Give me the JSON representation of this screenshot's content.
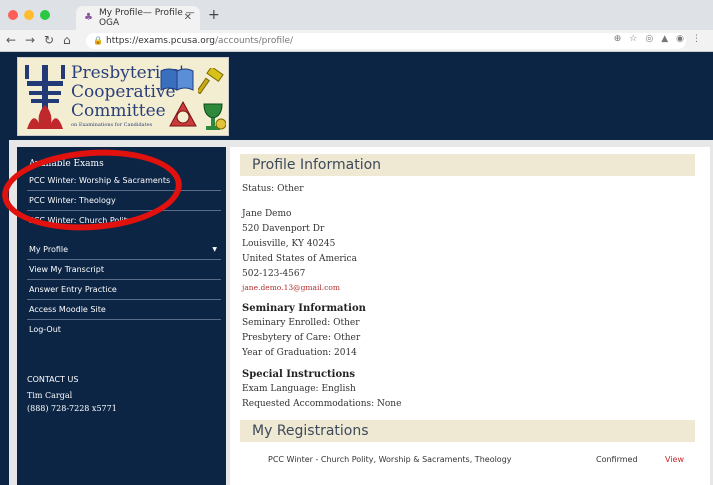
{
  "browser": {
    "tab_title": "My Profile— Profile — OGA",
    "url_host": "https://exams.pcusa.org",
    "url_path": "/accounts/profile/"
  },
  "logo": {
    "line1": "Presbyteries'",
    "line2": "Cooperative",
    "line3": "Committee",
    "line4": "on Examinations for Candidates"
  },
  "sidebar": {
    "exams_heading": "Available Exams",
    "exams": [
      {
        "label": "PCC Winter: Worship & Sacraments"
      },
      {
        "label": "PCC Winter: Theology"
      },
      {
        "label": "PCC Winter: Church Polity"
      }
    ],
    "menu": [
      {
        "label": "My Profile"
      },
      {
        "label": "View My Transcript"
      },
      {
        "label": "Answer Entry Practice"
      },
      {
        "label": "Access Moodle Site"
      },
      {
        "label": "Log-Out"
      }
    ],
    "contact_heading": "CONTACT US",
    "contact_name": "Tim Cargal",
    "contact_phone": "(888) 728-7228 x5771"
  },
  "profile": {
    "heading": "Profile Information",
    "status": "Status: Other",
    "name": "Jane Demo",
    "address1": "520 Davenport Dr",
    "address2": "Louisville, KY 40245",
    "country": "United States of America",
    "phone": "502-123-4567",
    "email": "jane.demo.13@gmail.com",
    "seminary_heading": "Seminary Information",
    "seminary_enrolled": "Seminary Enrolled: Other",
    "presbytery": "Presbytery of Care: Other",
    "graduation": "Year of Graduation: 2014",
    "special_heading": "Special Instructions",
    "language": "Exam Language: English",
    "accommodations": "Requested Accommodations: None"
  },
  "registrations": {
    "heading": "My Registrations",
    "items": [
      {
        "name": "PCC Winter - Church Polity, Worship & Sacraments, Theology",
        "status": "Confirmed",
        "action": "View"
      }
    ]
  },
  "colors": {
    "navy": "#0c2545",
    "highlight_circle": "#e1110e",
    "section_bar": "#efe8d3",
    "link_red": "#c62828"
  }
}
